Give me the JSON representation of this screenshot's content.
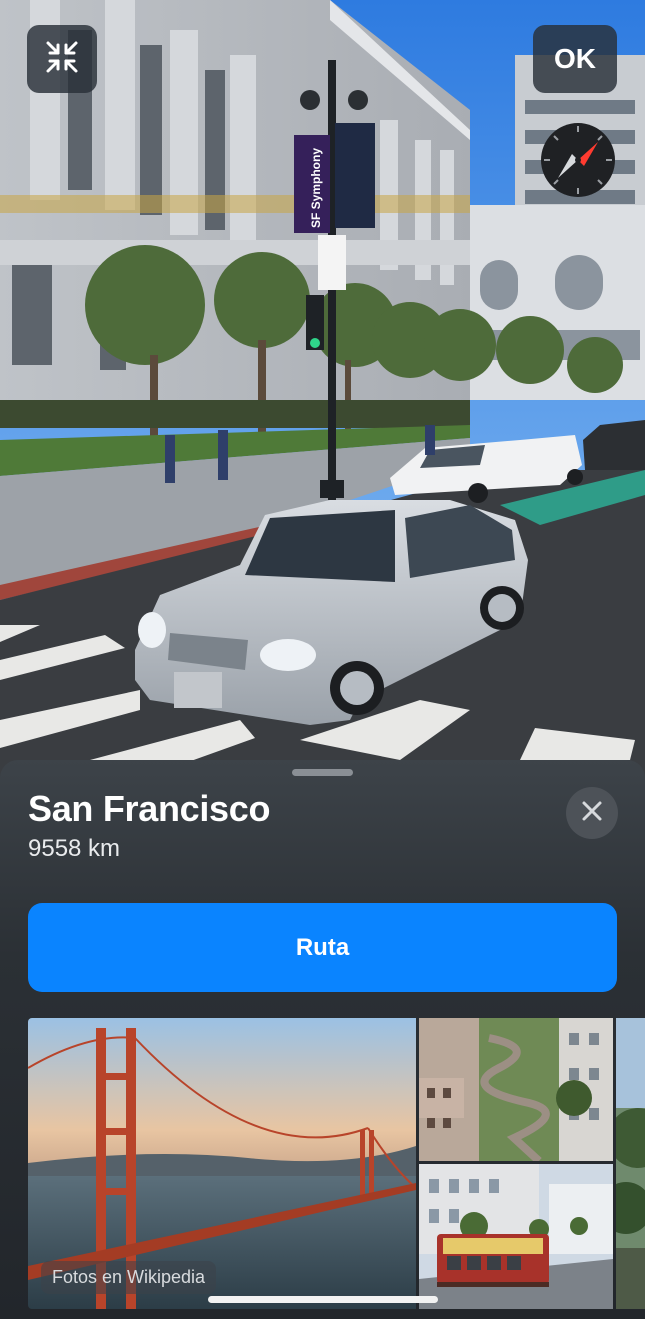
{
  "toolbar": {
    "collapse_icon": "arrows-in-icon",
    "ok_label": "OK",
    "compass_icon": "compass-icon"
  },
  "scene": {
    "banner_text": "SF Symphony"
  },
  "place": {
    "title": "San Francisco",
    "distance": "9558 km",
    "close_icon": "close-icon"
  },
  "actions": {
    "route_label": "Ruta"
  },
  "photos": {
    "source_label": "Fotos en Wikipedia",
    "items": [
      "golden-gate-bridge",
      "lombard-street",
      "cable-car",
      "tree"
    ]
  },
  "colors": {
    "accent": "#0a84ff",
    "sheet_bg": "#2b3035",
    "compass_needle": "#ff3b30"
  }
}
